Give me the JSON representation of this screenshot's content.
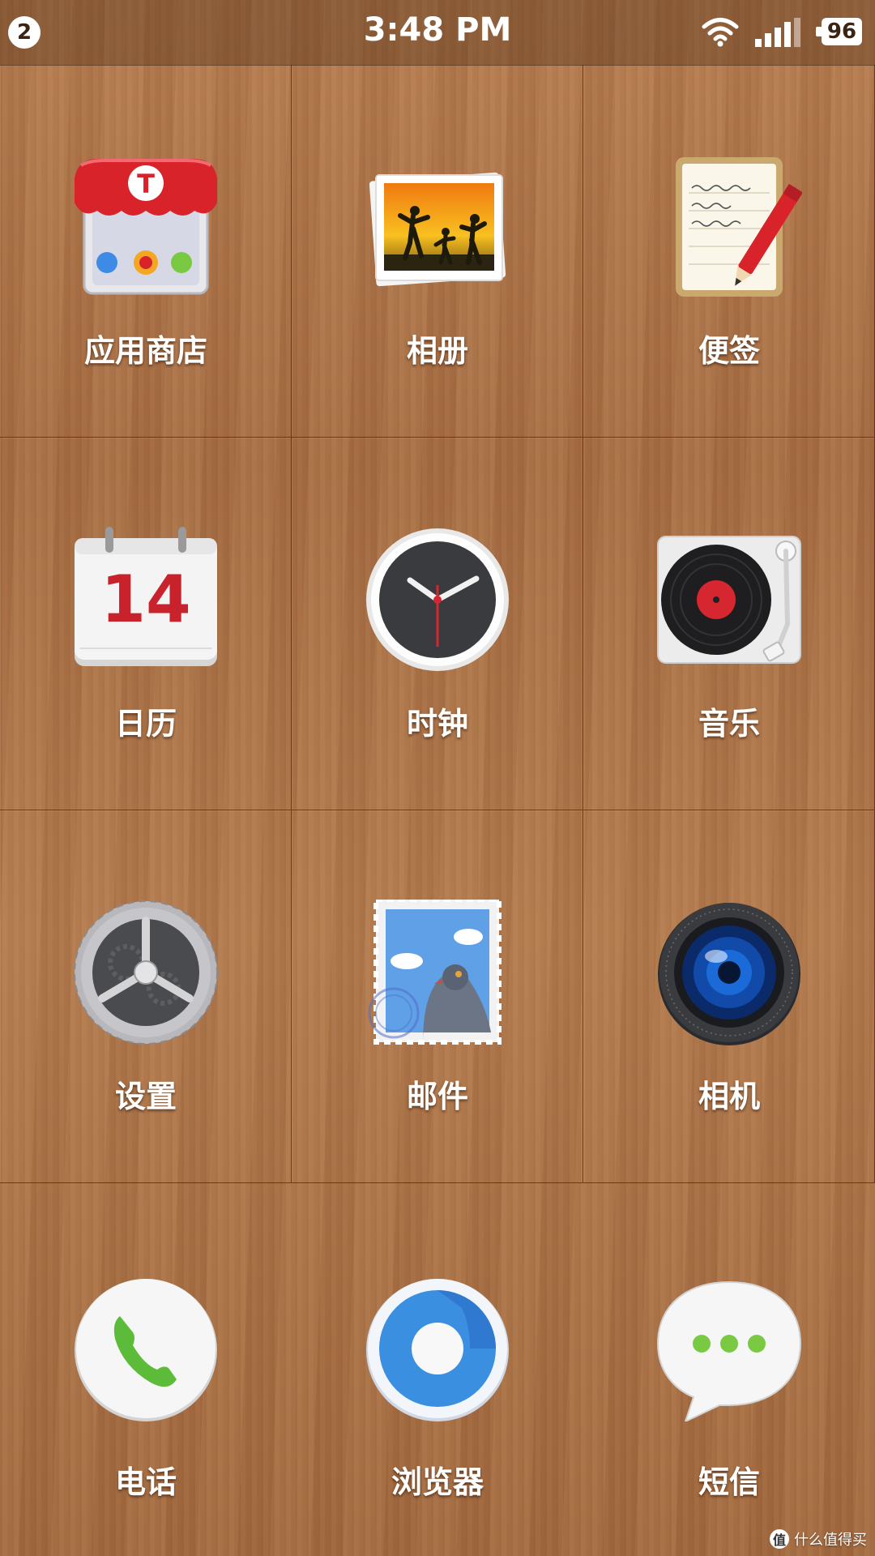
{
  "status_bar": {
    "notification_count": "2",
    "time": "3:48 PM",
    "battery": "96",
    "icons": [
      "wifi-icon",
      "signal-icon",
      "battery-icon"
    ]
  },
  "apps": [
    {
      "label": "应用商店",
      "icon": "app-store-icon"
    },
    {
      "label": "相册",
      "icon": "photos-icon"
    },
    {
      "label": "便签",
      "icon": "notes-icon"
    },
    {
      "label": "日历",
      "icon": "calendar-icon",
      "date": "14"
    },
    {
      "label": "时钟",
      "icon": "clock-icon"
    },
    {
      "label": "音乐",
      "icon": "music-icon"
    },
    {
      "label": "设置",
      "icon": "settings-icon"
    },
    {
      "label": "邮件",
      "icon": "mail-icon"
    },
    {
      "label": "相机",
      "icon": "camera-icon"
    }
  ],
  "dock": [
    {
      "label": "电话",
      "icon": "phone-icon"
    },
    {
      "label": "浏览器",
      "icon": "browser-icon"
    },
    {
      "label": "短信",
      "icon": "messages-icon"
    }
  ],
  "watermark": "什么值得买",
  "colors": {
    "wood": "#b07548",
    "accent_red": "#d6262f",
    "phone_green": "#5dbb3a"
  }
}
